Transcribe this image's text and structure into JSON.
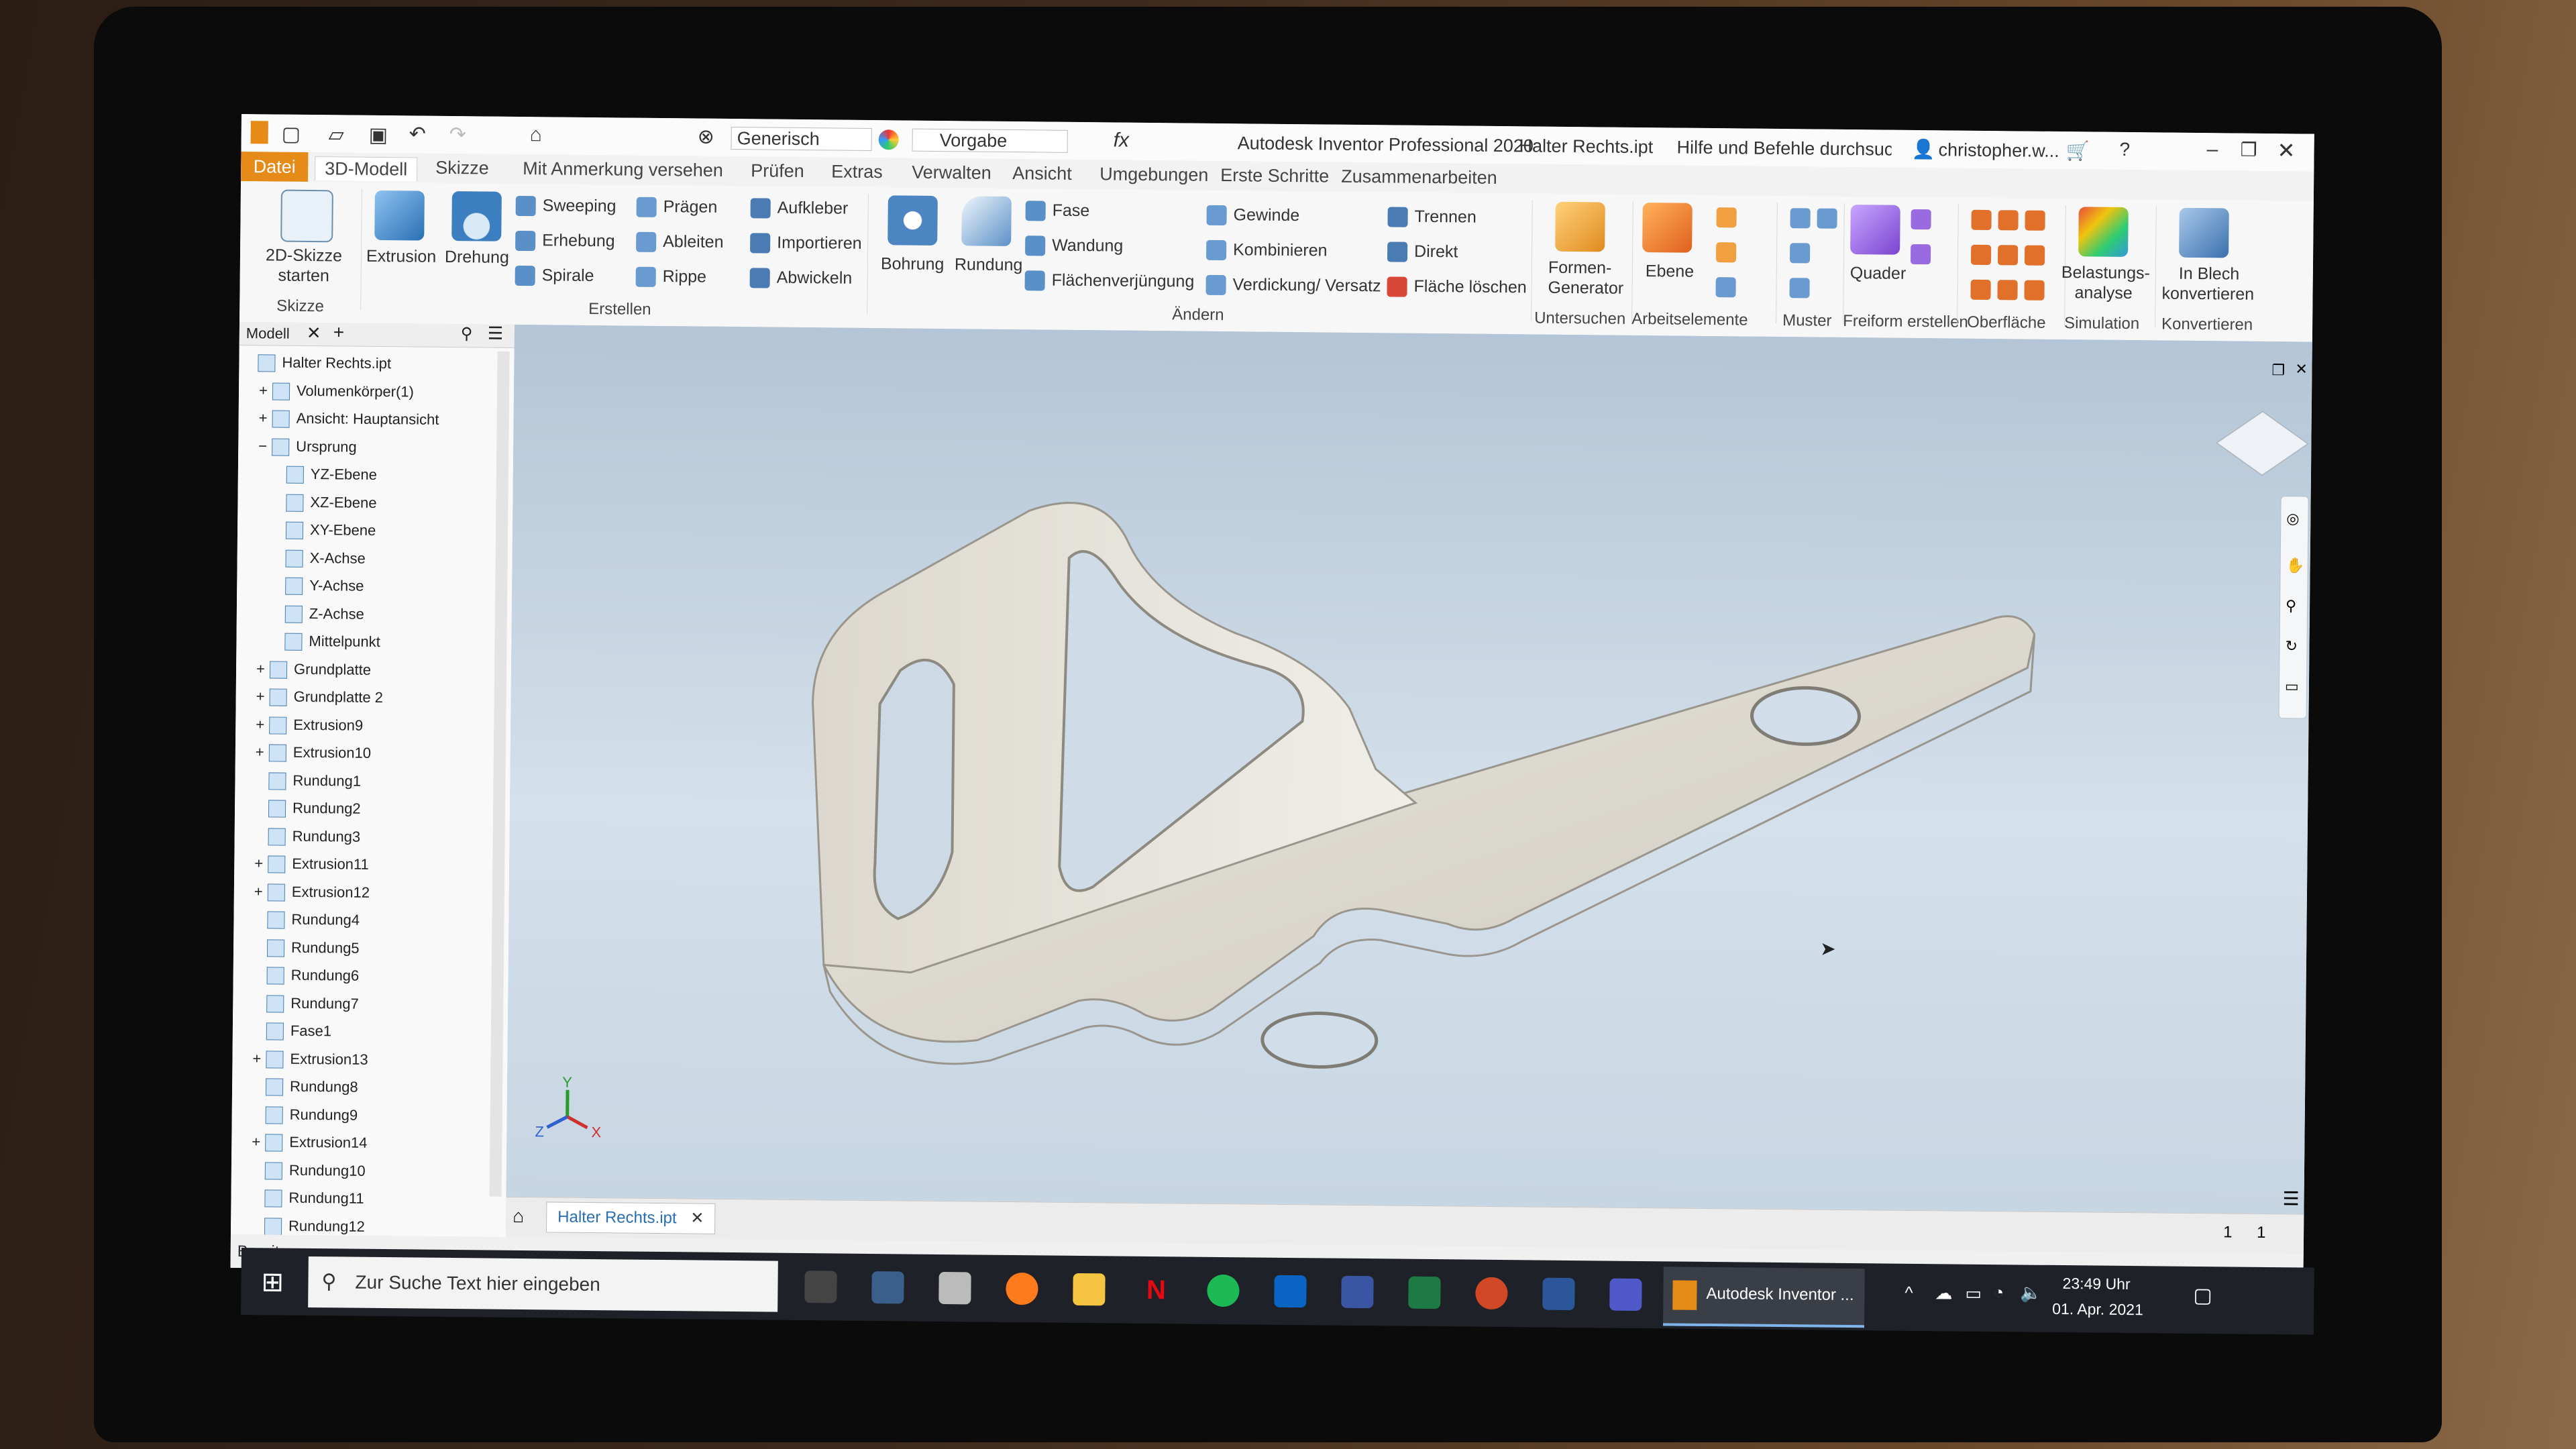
{
  "qat": {
    "appearance": "Generisch",
    "material": "Vorgabe",
    "title": "Autodesk Inventor Professional 2020",
    "document": "Halter Rechts.ipt",
    "search_placeholder": "Hilfe und Befehle durchsuchen...",
    "user": "christopher.w..."
  },
  "menu": {
    "file": "Datei",
    "tabs": [
      "3D-Modell",
      "Skizze",
      "Mit Anmerkung versehen",
      "Prüfen",
      "Extras",
      "Verwalten",
      "Ansicht",
      "Umgebungen",
      "Erste Schritte",
      "Zusammenarbeiten"
    ]
  },
  "ribbon": {
    "sketch": {
      "button": "2D-Skizze starten",
      "line1": "2D-Skizze",
      "line2": "starten",
      "group": "Skizze"
    },
    "create": {
      "extrusion": "Extrusion",
      "drehung": "Drehung",
      "col1": [
        "Sweeping",
        "Erhebung",
        "Spirale"
      ],
      "col2": [
        "Prägen",
        "Ableiten",
        "Rippe"
      ],
      "col3": [
        "Aufkleber",
        "Importieren",
        "Abwickeln"
      ],
      "group": "Erstellen"
    },
    "modify": {
      "bohrung": "Bohrung",
      "rundung": "Rundung",
      "col1": [
        "Fase",
        "Wandung",
        "Flächenverjüngung"
      ],
      "col2": [
        "Gewinde",
        "Kombinieren",
        "Verdickung/ Versatz"
      ],
      "col3": [
        "Trennen",
        "Direkt",
        "Fläche löschen"
      ],
      "group": "Ändern"
    },
    "explore": {
      "line1": "Formen-",
      "line2": "Generator",
      "group": "Untersuchen"
    },
    "workfeatures": {
      "ebene": "Ebene",
      "group": "Arbeitselemente"
    },
    "pattern": {
      "group": "Muster"
    },
    "freeform": {
      "quader": "Quader",
      "group": "Freiform erstellen"
    },
    "surface": {
      "group": "Oberfläche"
    },
    "simulation": {
      "line1": "Belastungs-",
      "line2": "analyse",
      "group": "Simulation"
    },
    "convert": {
      "line1": "In Blech",
      "line2": "konvertieren",
      "group": "Konvertieren"
    }
  },
  "browser": {
    "tab": "Modell",
    "nodes": [
      {
        "label": "Halter Rechts.ipt",
        "level": 0,
        "expander": ""
      },
      {
        "label": "Volumenkörper(1)",
        "level": 1,
        "expander": "+"
      },
      {
        "label": "Ansicht: Hauptansicht",
        "level": 1,
        "expander": "+"
      },
      {
        "label": "Ursprung",
        "level": 1,
        "expander": "−"
      },
      {
        "label": "YZ-Ebene",
        "level": 2,
        "expander": ""
      },
      {
        "label": "XZ-Ebene",
        "level": 2,
        "expander": ""
      },
      {
        "label": "XY-Ebene",
        "level": 2,
        "expander": ""
      },
      {
        "label": "X-Achse",
        "level": 2,
        "expander": ""
      },
      {
        "label": "Y-Achse",
        "level": 2,
        "expander": ""
      },
      {
        "label": "Z-Achse",
        "level": 2,
        "expander": ""
      },
      {
        "label": "Mittelpunkt",
        "level": 2,
        "expander": ""
      },
      {
        "label": "Grundplatte",
        "level": 1,
        "expander": "+"
      },
      {
        "label": "Grundplatte 2",
        "level": 1,
        "expander": "+"
      },
      {
        "label": "Extrusion9",
        "level": 1,
        "expander": "+"
      },
      {
        "label": "Extrusion10",
        "level": 1,
        "expander": "+"
      },
      {
        "label": "Rundung1",
        "level": 1,
        "expander": ""
      },
      {
        "label": "Rundung2",
        "level": 1,
        "expander": ""
      },
      {
        "label": "Rundung3",
        "level": 1,
        "expander": ""
      },
      {
        "label": "Extrusion11",
        "level": 1,
        "expander": "+"
      },
      {
        "label": "Extrusion12",
        "level": 1,
        "expander": "+"
      },
      {
        "label": "Rundung4",
        "level": 1,
        "expander": ""
      },
      {
        "label": "Rundung5",
        "level": 1,
        "expander": ""
      },
      {
        "label": "Rundung6",
        "level": 1,
        "expander": ""
      },
      {
        "label": "Rundung7",
        "level": 1,
        "expander": ""
      },
      {
        "label": "Fase1",
        "level": 1,
        "expander": ""
      },
      {
        "label": "Extrusion13",
        "level": 1,
        "expander": "+"
      },
      {
        "label": "Rundung8",
        "level": 1,
        "expander": ""
      },
      {
        "label": "Rundung9",
        "level": 1,
        "expander": ""
      },
      {
        "label": "Extrusion14",
        "level": 1,
        "expander": "+"
      },
      {
        "label": "Rundung10",
        "level": 1,
        "expander": ""
      },
      {
        "label": "Rundung11",
        "level": 1,
        "expander": ""
      },
      {
        "label": "Rundung12",
        "level": 1,
        "expander": ""
      }
    ]
  },
  "viewport": {
    "doc_tab": "Halter Rechts.ipt",
    "page_a": "1",
    "page_b": "1",
    "axes": [
      "Z",
      "Y",
      "X"
    ]
  },
  "status": {
    "text": "Bereit"
  },
  "taskbar": {
    "search_placeholder": "Zur Suche Text hier eingeben",
    "active_app": "Autodesk Inventor ...",
    "time": "23:49 Uhr",
    "date": "01. Apr. 2021",
    "icons": [
      "settings-icon",
      "calculator-icon",
      "snipping-icon",
      "firefox-icon",
      "explorer-icon",
      "netflix-icon",
      "spotify-icon",
      "outlook-icon",
      "visio-icon",
      "excel-icon",
      "powerpoint-icon",
      "word-icon",
      "teams-icon"
    ]
  },
  "colors": {
    "file_tab": "#e68a18",
    "viewport_top": "#b3c5d6",
    "part": "#dcd8cf",
    "taskbar": "#1e2228"
  }
}
